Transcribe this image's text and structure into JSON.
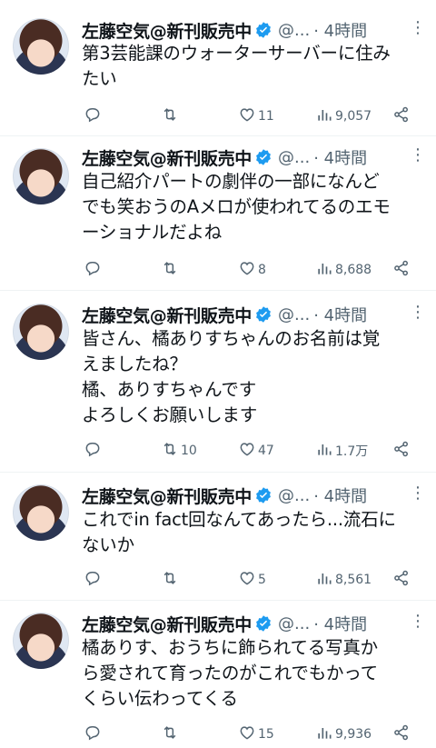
{
  "tweets": [
    {
      "name": "左藤空気@新刊販売中",
      "handle": "@...",
      "time": "· 4時間",
      "text": "第3芸能課のウォーターサーバーに住み\nたい",
      "replies": "",
      "retweets": "",
      "likes": "11",
      "views": "9,057"
    },
    {
      "name": "左藤空気@新刊販売中",
      "handle": "@...",
      "time": "· 4時間",
      "text": "自己紹介パートの劇伴の一部になんど\nでも笑おうのAメロが使われてるのエモ\nーショナルだよね",
      "replies": "",
      "retweets": "",
      "likes": "8",
      "views": "8,688"
    },
    {
      "name": "左藤空気@新刊販売中",
      "handle": "@...",
      "time": "· 4時間",
      "text": "皆さん、橘ありすちゃんのお名前は覚\nえましたね？\n橘、ありすちゃんです\nよろしくお願いします",
      "replies": "",
      "retweets": "10",
      "likes": "47",
      "views": "1.7万"
    },
    {
      "name": "左藤空気@新刊販売中",
      "handle": "@...",
      "time": "· 4時間",
      "text": "これでin fact回なんてあったら...流石に\nないか",
      "replies": "",
      "retweets": "",
      "likes": "5",
      "views": "8,561"
    },
    {
      "name": "左藤空気@新刊販売中",
      "handle": "@...",
      "time": "· 4時間",
      "text": "橘ありす、おうちに飾られてる写真か\nら愛されて育ったのがこれでもかって\nくらい伝わってくる",
      "replies": "",
      "retweets": "",
      "likes": "15",
      "views": "9,936"
    }
  ],
  "colors": {
    "verified": "#1d9bf0",
    "secondary_text": "#536471",
    "divider": "#eff3f4"
  },
  "icons": [
    "reply-icon",
    "retweet-icon",
    "like-icon",
    "views-icon",
    "share-icon",
    "verified-icon",
    "more-icon"
  ]
}
